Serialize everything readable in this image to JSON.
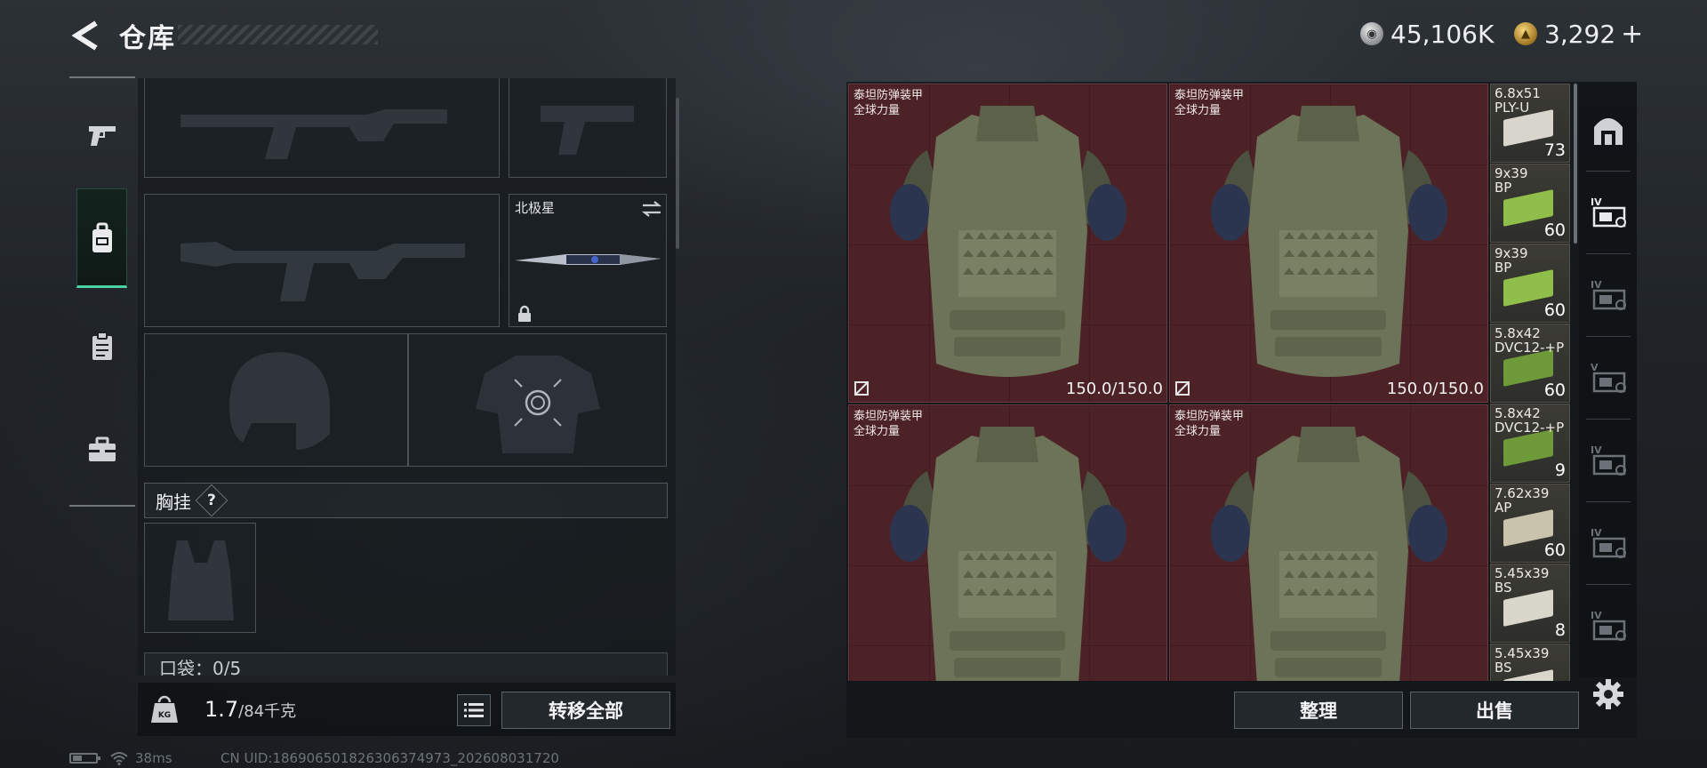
{
  "header": {
    "title": "仓库",
    "currency_silver": "45,106K",
    "currency_gold": "3,292",
    "currency_plus": "+"
  },
  "left_rail": {
    "items": [
      {
        "icon": "pistol-icon"
      },
      {
        "icon": "backpack-icon",
        "active": true
      },
      {
        "icon": "clipboard-icon"
      },
      {
        "icon": "toolbox-icon"
      }
    ]
  },
  "loadout": {
    "melee_name": "北极星",
    "swap_icon": "swap-icon",
    "lock_icon": "lock-icon",
    "chest_rig_label": "胸挂",
    "help_symbol": "?",
    "pocket_label": "口袋：0/5",
    "weight_current": "1.7",
    "weight_max": "/84千克",
    "weight_icon_text": "KG",
    "transfer_all": "转移全部"
  },
  "status": {
    "ping": "38ms",
    "uid": "CN UID:1869065018263063749​73_202608031720"
  },
  "storage": {
    "armors": [
      {
        "name_line1": "泰坦防弹装甲",
        "name_line2": "全球力量",
        "durability": "150.0/150.0"
      },
      {
        "name_line1": "泰坦防弹装甲",
        "name_line2": "全球力量",
        "durability": "150.0/150.0"
      },
      {
        "name_line1": "泰坦防弹装甲",
        "name_line2": "全球力量",
        "durability": ""
      },
      {
        "name_line1": "泰坦防弹装甲",
        "name_line2": "全球力量",
        "durability": ""
      }
    ],
    "ammo": [
      {
        "caliber": "6.8x51",
        "type": "PLY-U",
        "count": "73",
        "color": "#d8d6cc"
      },
      {
        "caliber": "9x39",
        "type": "BP",
        "count": "60",
        "color": "#8fbf4a"
      },
      {
        "caliber": "9x39",
        "type": "BP",
        "count": "60",
        "color": "#8fbf4a"
      },
      {
        "caliber": "5.8x42",
        "type": "DVC12-+P",
        "count": "60",
        "color": "#6f9a3a"
      },
      {
        "caliber": "5.8x42",
        "type": "DVC12-+P",
        "count": "9",
        "color": "#6f9a3a"
      },
      {
        "caliber": "7.62x39",
        "type": "AP",
        "count": "60",
        "color": "#c9c3ad"
      },
      {
        "caliber": "5.45x39",
        "type": "BS",
        "count": "8",
        "color": "#d9d6cc"
      },
      {
        "caliber": "5.45x39",
        "type": "BS",
        "count": "",
        "color": "#d9d6cc"
      }
    ],
    "sort_label": "整理",
    "sell_label": "出售"
  },
  "right_rail": {
    "items": [
      {
        "icon": "gate-icon",
        "label": ""
      },
      {
        "icon": "container-icon",
        "label": "IV"
      },
      {
        "icon": "container-icon",
        "label": "IV"
      },
      {
        "icon": "container-icon",
        "label": "V"
      },
      {
        "icon": "container-icon",
        "label": "IV"
      },
      {
        "icon": "container-icon",
        "label": "IV"
      },
      {
        "icon": "container-icon",
        "label": "IV"
      }
    ]
  }
}
